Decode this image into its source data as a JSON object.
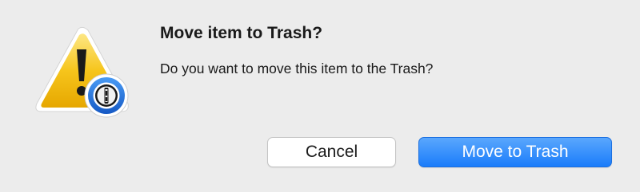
{
  "dialog": {
    "title": "Move item to Trash?",
    "message": "Do you want to move this item to the Trash?",
    "icon": "warning-triangle-with-1password-badge-icon"
  },
  "buttons": {
    "cancel_label": "Cancel",
    "confirm_label": "Move to Trash"
  },
  "colors": {
    "background": "#ececec",
    "accent": "#1a7cfa",
    "warning": "#f5c218",
    "badge_ring": "#1f6fd8"
  }
}
